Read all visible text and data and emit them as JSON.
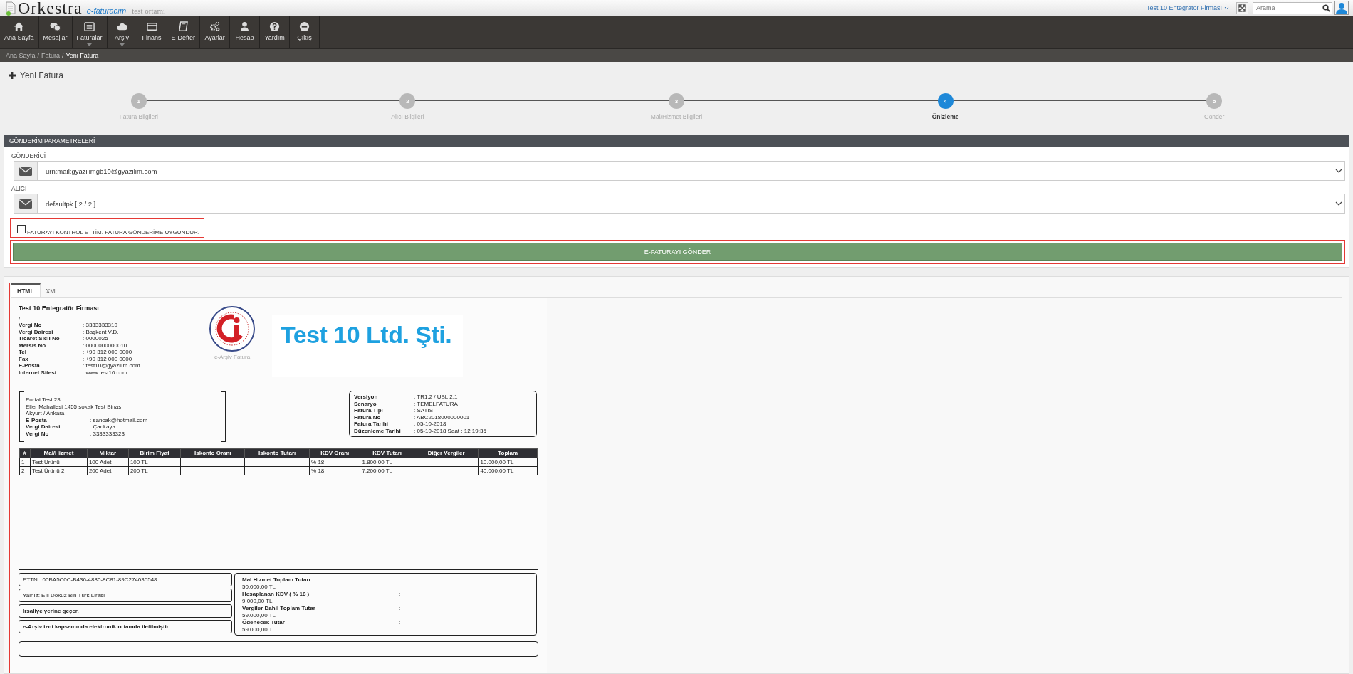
{
  "header": {
    "logo": "Orkestra",
    "product": "e-faturacım",
    "environment": "test ortamı",
    "company": "Test 10 Entegratör Firması",
    "search": {
      "placeholder": "Arama"
    }
  },
  "nav": [
    {
      "label": "Ana Sayfa",
      "has_menu": false
    },
    {
      "label": "Mesajlar",
      "has_menu": false
    },
    {
      "label": "Faturalar",
      "has_menu": true
    },
    {
      "label": "Arşiv",
      "has_menu": true
    },
    {
      "label": "Finans",
      "has_menu": false
    },
    {
      "label": "E-Defter",
      "has_menu": false
    },
    {
      "label": "Ayarlar",
      "has_menu": false
    },
    {
      "label": "Hesap",
      "has_menu": false
    },
    {
      "label": "Yardım",
      "has_menu": false
    },
    {
      "label": "Çıkış",
      "has_menu": false
    }
  ],
  "breadcrumb": {
    "separator": "/",
    "items": [
      "Ana Sayfa",
      "Fatura",
      "Yeni Fatura"
    ]
  },
  "page_title": "Yeni Fatura",
  "steps": [
    {
      "number": "1",
      "label": "Fatura Bilgileri",
      "selected": false
    },
    {
      "number": "2",
      "label": "Alıcı Bilgileri",
      "selected": false
    },
    {
      "number": "3",
      "label": "Mal/Hizmet Bilgileri",
      "selected": false
    },
    {
      "number": "4",
      "label": "Önizleme",
      "selected": true
    },
    {
      "number": "5",
      "label": "Gönder",
      "selected": false
    }
  ],
  "panel": {
    "title": "GÖNDERİM PARAMETRELERİ",
    "fields": [
      {
        "label": "GÖNDERİCİ",
        "value": "urn:mail:gyazilimgb10@gyazilim.com"
      },
      {
        "label": "ALICI",
        "value": "defaultpk [ 2 / 2 ]"
      }
    ],
    "confirm": {
      "label": "FATURAYI KONTROL ETTİM. FATURA GÖNDERİME UYGUNDUR.",
      "checked": false,
      "highlighted": true
    },
    "send_button": {
      "label": "E-FATURAYI GÖNDER",
      "highlighted": true
    }
  },
  "preview": {
    "highlighted": true,
    "tabs": [
      {
        "label": "HTML",
        "selected": true
      },
      {
        "label": "XML",
        "selected": false
      }
    ],
    "invoice": {
      "supplier": {
        "name": "Test 10 Entegratör Firması",
        "address": "/",
        "fields": [
          {
            "label": "Vergi No",
            "value": ": 3333333310"
          },
          {
            "label": "Vergi Dairesi",
            "value": ": Başkent V.D."
          },
          {
            "label": "Ticaret Sicil No",
            "value": ": 0000025"
          },
          {
            "label": "Mersis No",
            "value": ": 0000000000010"
          },
          {
            "label": "Tel",
            "value": ": +90 312 000 0000"
          },
          {
            "label": "Fax",
            "value": ": +90 312 000 0000"
          },
          {
            "label": "E-Posta",
            "value": ": test10@gyazilim.com"
          },
          {
            "label": "Internet Sitesi",
            "value": ": www.test10.com"
          }
        ]
      },
      "logo_caption": "e-Arşiv Fatura",
      "banner": "Test 10 Ltd. Şti.",
      "buyer": {
        "lines": [
          "Portal Test 23",
          "Eller Mahallesi 1455 sokak Test Binası",
          "Akyurt / Ankara"
        ],
        "fields": [
          {
            "label": "E-Posta",
            "value": ": sancak@hotmail.com"
          },
          {
            "label": "Vergi Dairesi",
            "value": ": Çankaya"
          },
          {
            "label": "Vergi No",
            "value": ": 3333333323"
          }
        ]
      },
      "info": [
        {
          "label": "Versiyon",
          "value": ": TR1.2 / UBL 2.1"
        },
        {
          "label": "Senaryo",
          "value": ": TEMELFATURA"
        },
        {
          "label": "Fatura Tipi",
          "value": ": SATIS"
        },
        {
          "label": "Fatura No",
          "value": ": ABC2018000000001"
        },
        {
          "label": "Fatura Tarihi",
          "value": ": 05-10-2018"
        },
        {
          "label": "Düzenleme Tarihi",
          "value": ": 05-10-2018 Saat : 12:19:35"
        }
      ],
      "columns": [
        "#",
        "Mal/Hizmet",
        "Miktar",
        "Birim Fiyat",
        "İskonto Oranı",
        "İskonto Tutarı",
        "KDV Oranı",
        "KDV Tutarı",
        "Diğer Vergiler",
        "Toplam"
      ],
      "rows": [
        [
          "1",
          "Test Ürünü",
          "100 Adet",
          "100 TL",
          null,
          null,
          "% 18",
          "1.800,00 TL",
          null,
          "10.000,00 TL"
        ],
        [
          "2",
          "Test Ürünü 2",
          "200 Adet",
          "200 TL",
          null,
          null,
          "% 18",
          "7.200,00 TL",
          null,
          "40.000,00 TL"
        ]
      ],
      "notes": [
        {
          "text": "ETTN : 00BA5C0C-B436-4880-8C81-89C274036548",
          "bold": false
        },
        {
          "text": "Yalnız: Elli Dokuz Bin Türk Lirası",
          "bold": false
        },
        {
          "text": "İrsaliye yerine geçer.",
          "bold": true
        },
        {
          "text": "e-Arşiv izni kapsamında elektronik ortamda iletilmiştir.",
          "bold": true
        }
      ],
      "totals": [
        {
          "label": "Mal Hizmet Toplam Tutarı",
          "sep": ":",
          "value": "50.000,00 TL"
        },
        {
          "label": "Hesaplanan KDV ( % 18 )",
          "sep": ":",
          "value": "9.000,00 TL"
        },
        {
          "label": "Vergiler Dahil Toplam Tutar",
          "sep": ":",
          "value": "59.000,00 TL"
        },
        {
          "label": "Ödenecek Tutar",
          "sep": ":",
          "value": "59.000,00  TL"
        }
      ]
    }
  }
}
